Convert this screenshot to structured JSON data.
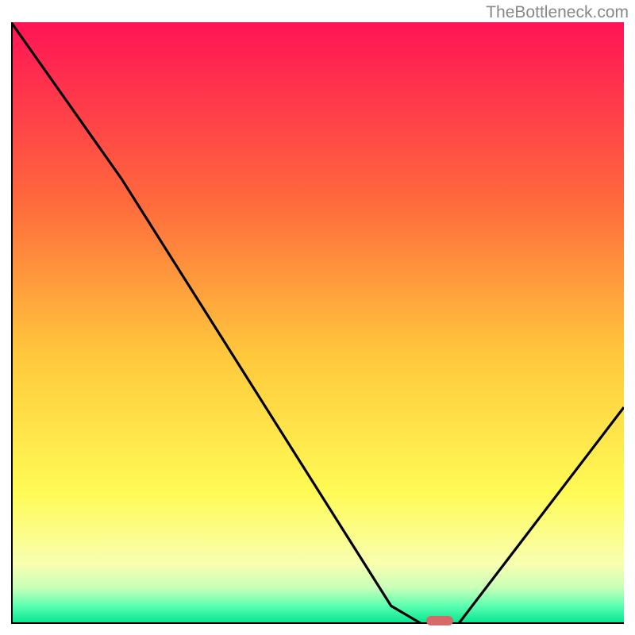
{
  "watermark": "TheBottleneck.com",
  "chart_data": {
    "type": "line",
    "title": "",
    "xlabel": "",
    "ylabel": "",
    "x_range": [
      0,
      100
    ],
    "y_range": [
      0,
      100
    ],
    "curve": [
      {
        "x": 0,
        "y": 100
      },
      {
        "x": 18,
        "y": 74
      },
      {
        "x": 62,
        "y": 3
      },
      {
        "x": 67,
        "y": 0
      },
      {
        "x": 73,
        "y": 0
      },
      {
        "x": 100,
        "y": 36
      }
    ],
    "marker": {
      "x": 70,
      "y": 0.5
    },
    "gradient_stops": [
      {
        "offset": 0,
        "color": "#ff1456"
      },
      {
        "offset": 30,
        "color": "#ff6a3c"
      },
      {
        "offset": 55,
        "color": "#ffc73c"
      },
      {
        "offset": 78,
        "color": "#fffb55"
      },
      {
        "offset": 90,
        "color": "#f8ffb0"
      },
      {
        "offset": 94,
        "color": "#c8ffb8"
      },
      {
        "offset": 97,
        "color": "#5cffb0"
      },
      {
        "offset": 100,
        "color": "#00e590"
      }
    ]
  }
}
